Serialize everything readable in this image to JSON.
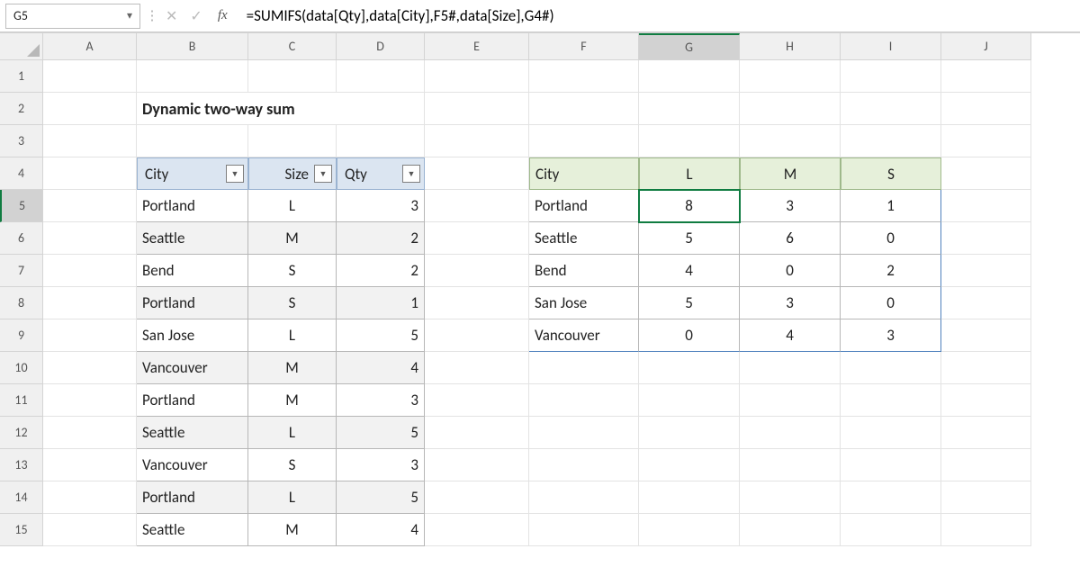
{
  "nameBox": "G5",
  "formula": "=SUMIFS(data[Qty],data[City],F5#,data[Size],G4#)",
  "colHeaders": [
    "A",
    "B",
    "C",
    "D",
    "E",
    "F",
    "G",
    "H",
    "I",
    "J"
  ],
  "rowHeaders": [
    "1",
    "2",
    "3",
    "4",
    "5",
    "6",
    "7",
    "8",
    "9",
    "10",
    "11",
    "12",
    "13",
    "14",
    "15"
  ],
  "title": "Dynamic two-way sum",
  "tableHeaders": {
    "city": "City",
    "size": "Size",
    "qty": "Qty"
  },
  "tableRows": [
    {
      "city": "Portland",
      "size": "L",
      "qty": "3"
    },
    {
      "city": "Seattle",
      "size": "M",
      "qty": "2"
    },
    {
      "city": "Bend",
      "size": "S",
      "qty": "2"
    },
    {
      "city": "Portland",
      "size": "S",
      "qty": "1"
    },
    {
      "city": "San Jose",
      "size": "L",
      "qty": "5"
    },
    {
      "city": "Vancouver",
      "size": "M",
      "qty": "4"
    },
    {
      "city": "Portland",
      "size": "M",
      "qty": "3"
    },
    {
      "city": "Seattle",
      "size": "L",
      "qty": "5"
    },
    {
      "city": "Vancouver",
      "size": "S",
      "qty": "3"
    },
    {
      "city": "Portland",
      "size": "L",
      "qty": "5"
    },
    {
      "city": "Seattle",
      "size": "M",
      "qty": "4"
    }
  ],
  "summary": {
    "header": {
      "city": "City",
      "s1": "L",
      "s2": "M",
      "s3": "S"
    },
    "rows": [
      {
        "city": "Portland",
        "l": "8",
        "m": "3",
        "s": "1"
      },
      {
        "city": "Seattle",
        "l": "5",
        "m": "6",
        "s": "0"
      },
      {
        "city": "Bend",
        "l": "4",
        "m": "0",
        "s": "2"
      },
      {
        "city": "San Jose",
        "l": "5",
        "m": "3",
        "s": "0"
      },
      {
        "city": "Vancouver",
        "l": "0",
        "m": "4",
        "s": "3"
      }
    ]
  },
  "chart_data": {
    "type": "table",
    "title": "Dynamic two-way sum",
    "columns": [
      "City",
      "L",
      "M",
      "S"
    ],
    "rows": [
      [
        "Portland",
        8,
        3,
        1
      ],
      [
        "Seattle",
        5,
        6,
        0
      ],
      [
        "Bend",
        4,
        0,
        2
      ],
      [
        "San Jose",
        5,
        3,
        0
      ],
      [
        "Vancouver",
        0,
        4,
        3
      ]
    ]
  }
}
